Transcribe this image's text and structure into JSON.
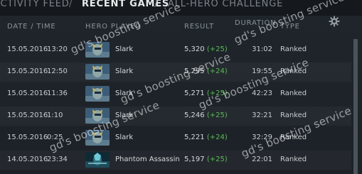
{
  "tabs": [
    {
      "label": "ACTIVITY FEED"
    },
    {
      "label": "RECENT GAMES"
    },
    {
      "label": "ALL-HERO CHALLENGE"
    }
  ],
  "tab_separator": "/",
  "columns": {
    "date_time": "DATE / TIME",
    "hero_played": "HERO PLAYED",
    "result": "RESULT",
    "duration": "DURATION",
    "type": "TYPE"
  },
  "rows": [
    {
      "date": "15.05.2016",
      "time": "13:20",
      "hero": "Slark",
      "mmr": "5,320",
      "delta": "(+25)",
      "duration": "31:02",
      "type": "Ranked"
    },
    {
      "date": "15.05.2016",
      "time": "12:50",
      "hero": "Slark",
      "mmr": "5,295",
      "delta": "(+24)",
      "duration": "19:55",
      "type": "Ranked"
    },
    {
      "date": "15.05.2016",
      "time": "11:36",
      "hero": "Slark",
      "mmr": "5,271",
      "delta": "(+25)",
      "duration": "42:23",
      "type": "Ranked"
    },
    {
      "date": "15.05.2016",
      "time": "1:10",
      "hero": "Slark",
      "mmr": "5,246",
      "delta": "(+25)",
      "duration": "32:21",
      "type": "Ranked"
    },
    {
      "date": "15.05.2016",
      "time": "0:25",
      "hero": "Slark",
      "mmr": "5,221",
      "delta": "(+24)",
      "duration": "32:29",
      "type": "Ranked"
    },
    {
      "date": "14.05.2016",
      "time": "23:34",
      "hero": "Phantom Assassin",
      "mmr": "5,197",
      "delta": "(+25)",
      "duration": "22:01",
      "type": "Ranked"
    }
  ],
  "watermark": "gd's boosting service",
  "icons": {
    "settings": "gear-icon"
  },
  "colors": {
    "positive": "#5fb85a",
    "background": "#1b1f24"
  }
}
